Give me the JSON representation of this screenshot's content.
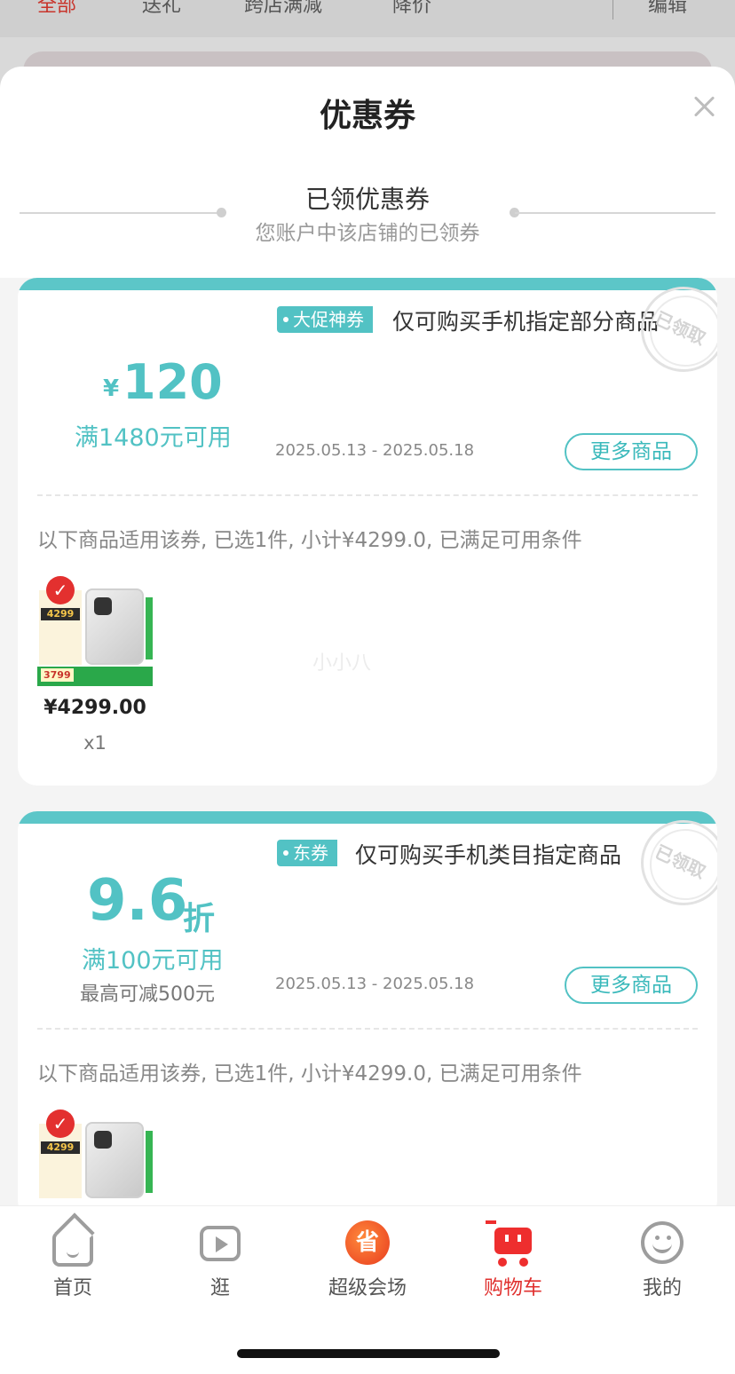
{
  "top_tabs": [
    {
      "label": "全部",
      "active": true
    },
    {
      "label": "送礼",
      "active": false
    },
    {
      "label": "跨店满减",
      "active": false
    },
    {
      "label": "降价",
      "active": false
    }
  ],
  "top_edit": "编辑",
  "sheet": {
    "title": "优惠券",
    "section_title": "已领优惠券",
    "section_subtitle": "您账户中该店铺的已领券"
  },
  "coupons": [
    {
      "tag": "大促神券",
      "limit": "仅可购买手机指定部分商品",
      "stamp": "已领取",
      "currency": "¥",
      "amount": "120",
      "condition": "满1480元可用",
      "date": "2025.05.13 - 2025.05.18",
      "more": "更多商品",
      "applies": "以下商品适用该券, 已选1件, 小计¥4299.0, 已满足可用条件",
      "product": {
        "badge_price": "4299",
        "promo_price": "3799",
        "price": "¥4299.00",
        "qty": "x1"
      }
    },
    {
      "tag": "东券",
      "limit": "仅可购买手机类目指定商品",
      "stamp": "已领取",
      "amount": "9.6",
      "unit": "折",
      "condition": "满100元可用",
      "cap": "最高可减500元",
      "date": "2025.05.13 - 2025.05.18",
      "more": "更多商品",
      "applies": "以下商品适用该券, 已选1件, 小计¥4299.0, 已满足可用条件",
      "product": {
        "badge_price": "4299"
      }
    }
  ],
  "watermark": "小小八",
  "nav": [
    {
      "label": "首页",
      "icon": "home-icon",
      "active": false
    },
    {
      "label": "逛",
      "icon": "video-icon",
      "active": false
    },
    {
      "label": "超级会场",
      "icon": "super-venue-icon",
      "icon_text": "省",
      "active": false
    },
    {
      "label": "购物车",
      "icon": "cart-icon",
      "active": true
    },
    {
      "label": "我的",
      "icon": "smiley-icon",
      "active": false
    }
  ],
  "colors": {
    "teal": "#52c2c4",
    "red": "#e0302e"
  }
}
